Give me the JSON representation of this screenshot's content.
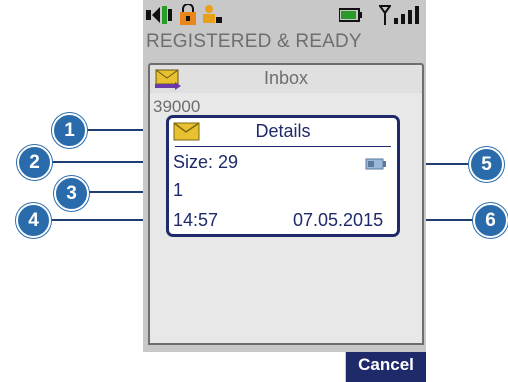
{
  "status_bar": {
    "icons": [
      "signal-strength-icon-left",
      "lock-icon",
      "user-status-icon",
      "battery-icon",
      "antenna-icon",
      "signal-bars-icon"
    ]
  },
  "registration": {
    "text": "REGISTERED & READY"
  },
  "inbox": {
    "title": "Inbox",
    "icon": "envelope-arrow-icon"
  },
  "message": {
    "sender": "39000"
  },
  "details_dialog": {
    "title": "Details",
    "icon": "envelope-icon",
    "size_label": "Size: 29",
    "count": "1",
    "time": "14:57",
    "date": "07.05.2015",
    "attachment_icon": "battery-small-icon"
  },
  "softkeys": {
    "cancel_label": "Cancel"
  },
  "callouts": [
    "1",
    "2",
    "3",
    "4",
    "5",
    "6"
  ],
  "colors": {
    "dialog_border": "#1e2a6a",
    "callout": "#2a6cab",
    "screen_bg": "#c8c8c8"
  }
}
